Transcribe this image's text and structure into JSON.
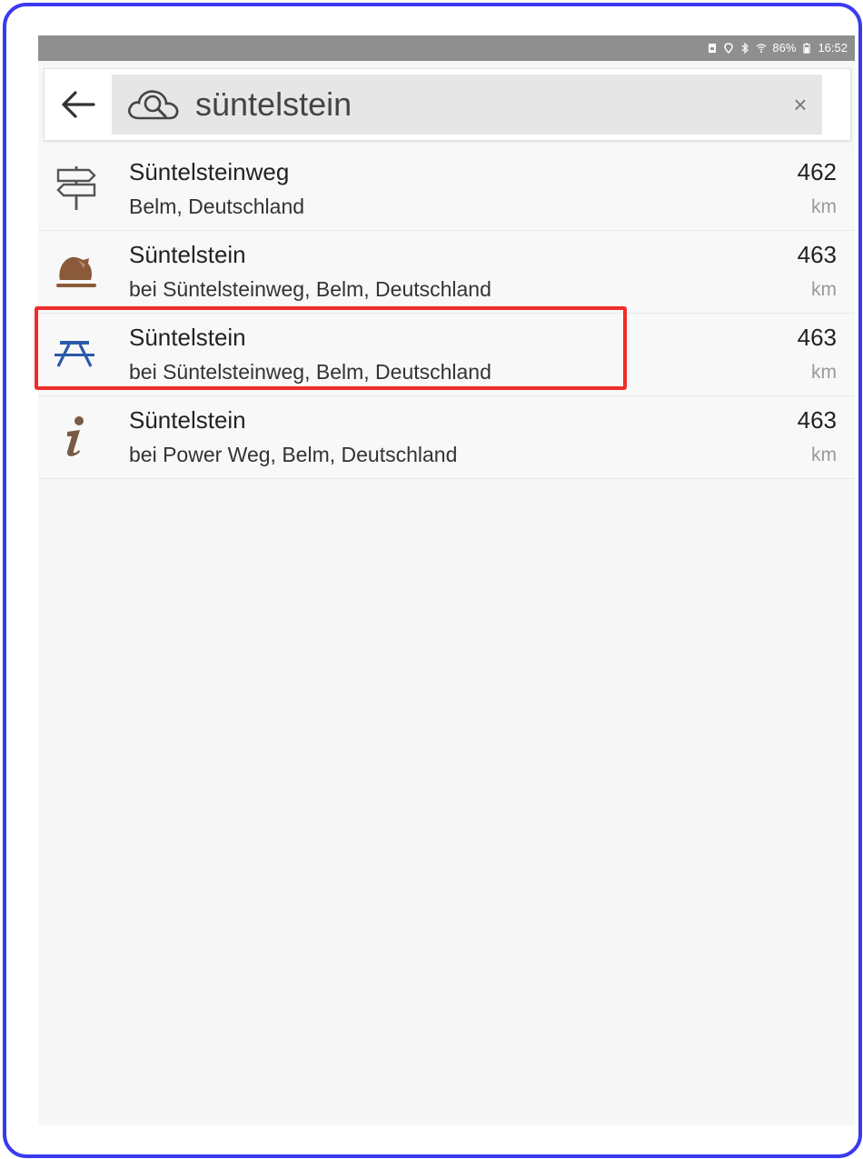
{
  "status_bar": {
    "battery_percent": "86%",
    "time": "16:52",
    "icons": [
      "sim-icon",
      "location-icon",
      "bluetooth-icon",
      "wifi-icon",
      "battery-icon"
    ]
  },
  "search": {
    "query": "süntelstein",
    "clear_label": "×"
  },
  "results": [
    {
      "title": "Süntelsteinweg",
      "subtitle": "Belm, Deutschland",
      "distance": "462",
      "unit": "km",
      "icon": "signpost-icon"
    },
    {
      "title": "Süntelstein",
      "subtitle": "bei Süntelsteinweg, Belm, Deutschland",
      "distance": "463",
      "unit": "km",
      "icon": "boulder-icon"
    },
    {
      "title": "Süntelstein",
      "subtitle": "bei Süntelsteinweg, Belm, Deutschland",
      "distance": "463",
      "unit": "km",
      "icon": "picnic-table-icon",
      "highlighted": true
    },
    {
      "title": "Süntelstein",
      "subtitle": "bei Power Weg, Belm, Deutschland",
      "distance": "463",
      "unit": "km",
      "icon": "info-icon"
    }
  ],
  "colors": {
    "frame": "#3a3af0",
    "highlight": "#ef2c2c",
    "picnic_icon": "#2a5aa8",
    "boulder_icon": "#8a5a3a",
    "info_icon": "#7a5a44"
  }
}
